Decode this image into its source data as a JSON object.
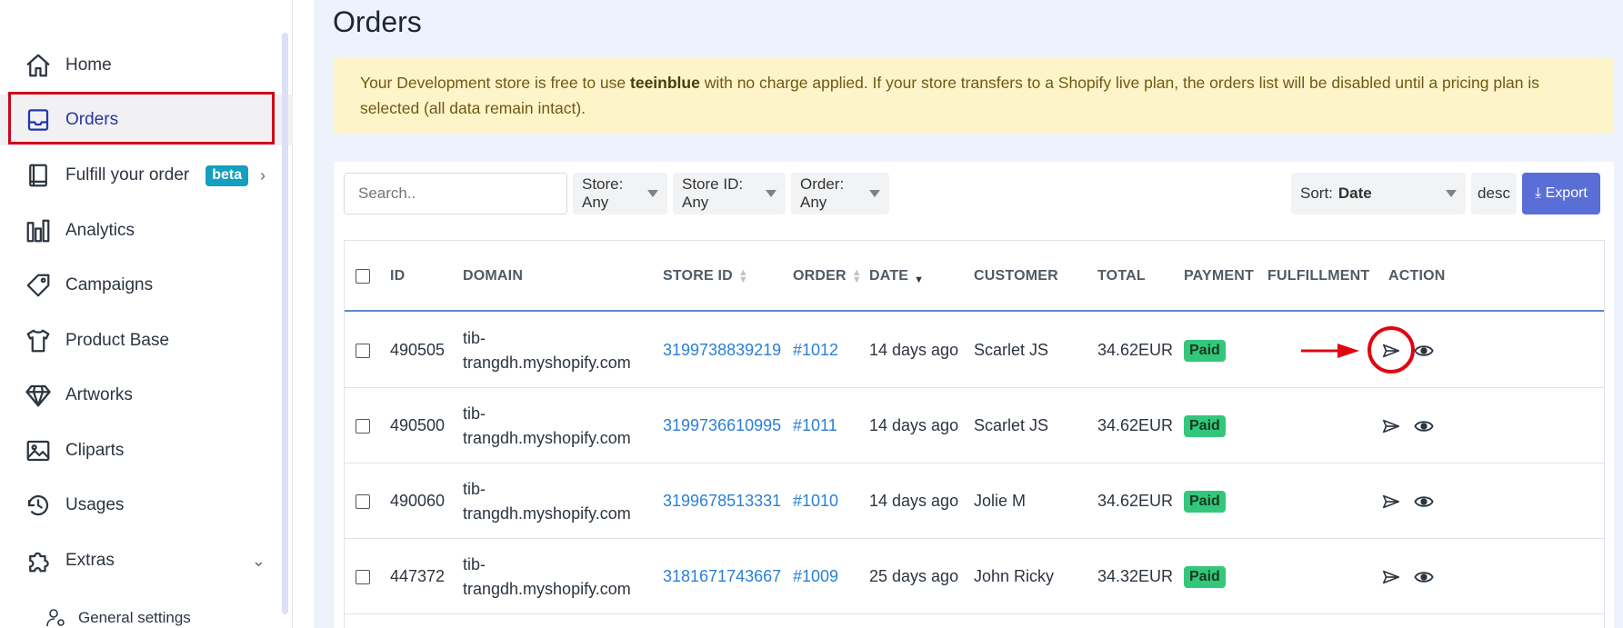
{
  "sidebar": {
    "items": [
      {
        "label": "Home",
        "icon": "home-icon"
      },
      {
        "label": "Orders",
        "icon": "inbox-icon"
      },
      {
        "label": "Fulfill your order",
        "icon": "book-icon",
        "badge": "beta"
      },
      {
        "label": "Analytics",
        "icon": "bar-chart-icon"
      },
      {
        "label": "Campaigns",
        "icon": "tag-icon"
      },
      {
        "label": "Product Base",
        "icon": "tshirt-icon"
      },
      {
        "label": "Artworks",
        "icon": "diamond-icon"
      },
      {
        "label": "Cliparts",
        "icon": "image-icon"
      },
      {
        "label": "Usages",
        "icon": "history-icon"
      },
      {
        "label": "Extras",
        "icon": "puzzle-icon"
      }
    ],
    "sub_item": "General settings"
  },
  "main": {
    "title": "Orders",
    "notice": {
      "before": "Your Development store is free to use ",
      "brand": "teeinblue",
      "after": " with no charge applied. If your store transfers to a Shopify live plan, the orders list will be disabled until a pricing plan is selected (all data remain intact)."
    },
    "toolbar": {
      "search_placeholder": "Search..",
      "store_filter": "Store: Any",
      "store_id_filter": "Store ID: Any",
      "order_filter": "Order: Any",
      "sort_label": "Sort:",
      "sort_value": "Date",
      "direction": "desc",
      "export": "⤓ Export"
    },
    "table": {
      "headers": {
        "id": "ID",
        "domain": "DOMAIN",
        "store_id": "STORE ID",
        "order": "ORDER",
        "date": "DATE",
        "customer": "CUSTOMER",
        "total": "TOTAL",
        "payment": "PAYMENT",
        "fulfillment": "FULFILLMENT",
        "action": "ACTION"
      },
      "rows": [
        {
          "id": "490505",
          "domain_a": "tib-",
          "domain_b": "trangdh.myshopify.com",
          "store_id": "3199738839219",
          "order": "#1012",
          "date": "14 days ago",
          "customer": "Scarlet JS",
          "total": "34.62EUR",
          "payment": "Paid"
        },
        {
          "id": "490500",
          "domain_a": "tib-",
          "domain_b": "trangdh.myshopify.com",
          "store_id": "3199736610995",
          "order": "#1011",
          "date": "14 days ago",
          "customer": "Scarlet JS",
          "total": "34.62EUR",
          "payment": "Paid"
        },
        {
          "id": "490060",
          "domain_a": "tib-",
          "domain_b": "trangdh.myshopify.com",
          "store_id": "3199678513331",
          "order": "#1010",
          "date": "14 days ago",
          "customer": "Jolie M",
          "total": "34.62EUR",
          "payment": "Paid"
        },
        {
          "id": "447372",
          "domain_a": "tib-",
          "domain_b": "trangdh.myshopify.com",
          "store_id": "3181671743667",
          "order": "#1009",
          "date": "25 days ago",
          "customer": "John Ricky",
          "total": "34.32EUR",
          "payment": "Paid"
        }
      ]
    }
  },
  "colors": {
    "accent": "#2337a8",
    "annotation": "#d0021b",
    "paid": "#34c77b",
    "link": "#2b7fd6",
    "export": "#5a6fd6"
  }
}
